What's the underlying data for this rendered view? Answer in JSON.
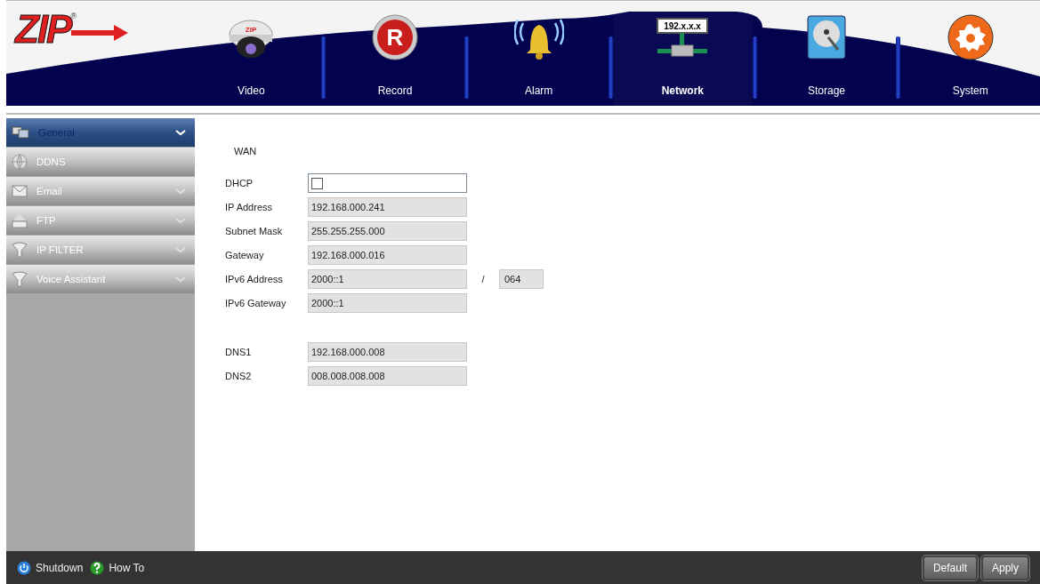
{
  "logo": {
    "text": "ZIP",
    "mark": "®"
  },
  "nav_tabs": [
    {
      "label": "Video",
      "icon_text": "ZIP",
      "selected": false
    },
    {
      "label": "Record",
      "icon_text": "R",
      "selected": false
    },
    {
      "label": "Alarm",
      "selected": false
    },
    {
      "label": "Network",
      "icon_text": "192.x.x.x",
      "selected": true
    },
    {
      "label": "Storage",
      "selected": false
    },
    {
      "label": "System",
      "selected": false
    }
  ],
  "sidebar": {
    "items": [
      {
        "label": "General",
        "selected": true,
        "expandable": true
      },
      {
        "label": "DDNS",
        "selected": false,
        "expandable": false
      },
      {
        "label": "Email",
        "selected": false,
        "expandable": true
      },
      {
        "label": "FTP",
        "selected": false,
        "expandable": true
      },
      {
        "label": "IP FILTER",
        "selected": false,
        "expandable": true
      },
      {
        "label": "Voice Assistant",
        "selected": false,
        "expandable": true
      }
    ]
  },
  "form": {
    "section": "WAN",
    "groups": [
      [
        {
          "kind": "checkbox",
          "label": "DHCP",
          "checked": false
        },
        {
          "kind": "text",
          "label": "IP Address",
          "value": "192.168.000.241",
          "disabled": true
        },
        {
          "kind": "text",
          "label": "Subnet Mask",
          "value": "255.255.255.000",
          "disabled": true
        },
        {
          "kind": "text",
          "label": "Gateway",
          "value": "192.168.000.016",
          "disabled": true
        },
        {
          "kind": "text",
          "label": "IPv6 Address",
          "value": "2000::1",
          "disabled": true,
          "separator": "/",
          "prefix": "064"
        },
        {
          "kind": "text",
          "label": "IPv6 Gateway",
          "value": "2000::1",
          "disabled": true
        }
      ],
      [
        {
          "kind": "text",
          "label": "DNS1",
          "value": "192.168.000.008",
          "disabled": true
        },
        {
          "kind": "text",
          "label": "DNS2",
          "value": "008.008.008.008",
          "disabled": true
        }
      ]
    ]
  },
  "footer": {
    "links": [
      {
        "label": "Shutdown"
      },
      {
        "label": "How To"
      }
    ],
    "buttons": [
      "Default",
      "Apply"
    ]
  }
}
